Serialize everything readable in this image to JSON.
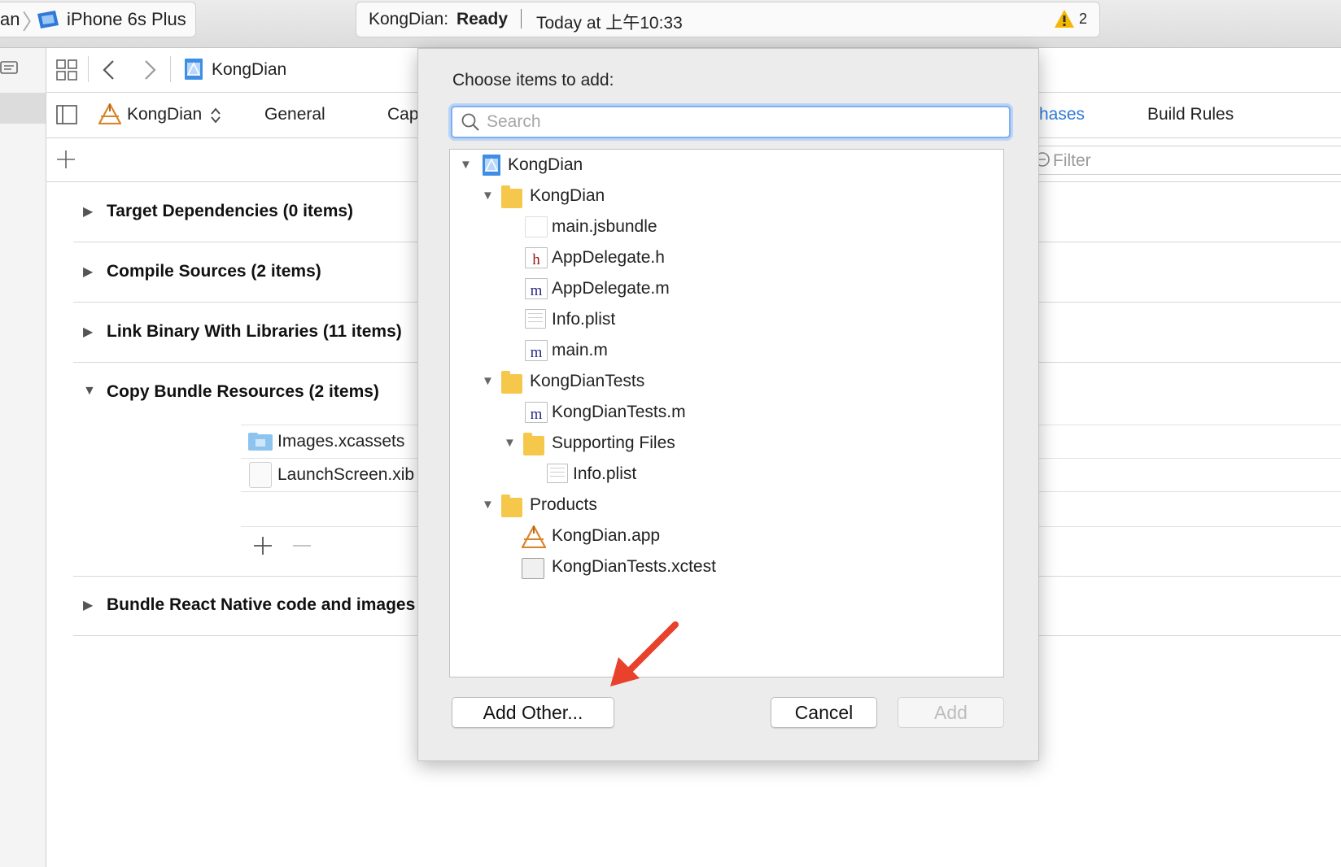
{
  "toolbar": {
    "scheme_partial": "an",
    "device": "iPhone 6s Plus",
    "status_project": "KongDian:",
    "status_state": "Ready",
    "status_time": "Today at 上午10:33",
    "warning_count": "2"
  },
  "navbar": {
    "project_name": "KongDian"
  },
  "tabs": {
    "target": "KongDian",
    "general": "General",
    "capabilities_partial": "Cap",
    "build_phases_partial": "hases",
    "build_rules": "Build Rules"
  },
  "filter": {
    "placeholder": "Filter"
  },
  "phases": [
    {
      "label": "Target Dependencies (0 items)"
    },
    {
      "label": "Compile Sources (2 items)"
    },
    {
      "label": "Link Binary With Libraries (11 items)"
    },
    {
      "label": "Copy Bundle Resources (2 items)"
    },
    {
      "label": "Bundle React Native code and images"
    }
  ],
  "resources": [
    {
      "name": "Images.xcassets"
    },
    {
      "name": "LaunchScreen.xib"
    }
  ],
  "dialog": {
    "title": "Choose items to add:",
    "search_placeholder": "Search",
    "tree": [
      {
        "label": "KongDian"
      },
      {
        "label": "KongDian"
      },
      {
        "label": "main.jsbundle"
      },
      {
        "label": "AppDelegate.h"
      },
      {
        "label": "AppDelegate.m"
      },
      {
        "label": "Info.plist"
      },
      {
        "label": "main.m"
      },
      {
        "label": "KongDianTests"
      },
      {
        "label": "KongDianTests.m"
      },
      {
        "label": "Supporting Files"
      },
      {
        "label": "Info.plist"
      },
      {
        "label": "Products"
      },
      {
        "label": "KongDian.app"
      },
      {
        "label": "KongDianTests.xctest"
      }
    ],
    "buttons": {
      "add_other": "Add Other...",
      "cancel": "Cancel",
      "add": "Add"
    }
  },
  "colors": {
    "accent": "#2f7ad8",
    "warning": "#f5b800",
    "folder": "#f5c74a",
    "arrow": "#e8412c"
  },
  "icons": [
    "apple-device-icon",
    "warning-icon",
    "grid-icon",
    "back-chevron-icon",
    "forward-chevron-icon",
    "project-file-icon",
    "sidebar-toggle-icon",
    "app-target-icon",
    "updown-icon",
    "plus-icon",
    "filter-icon",
    "search-icon",
    "folder-icon",
    "header-file-icon",
    "implementation-file-icon",
    "plist-file-icon",
    "xcassets-icon",
    "xib-icon",
    "xctest-icon",
    "red-arrow-annotation"
  ]
}
